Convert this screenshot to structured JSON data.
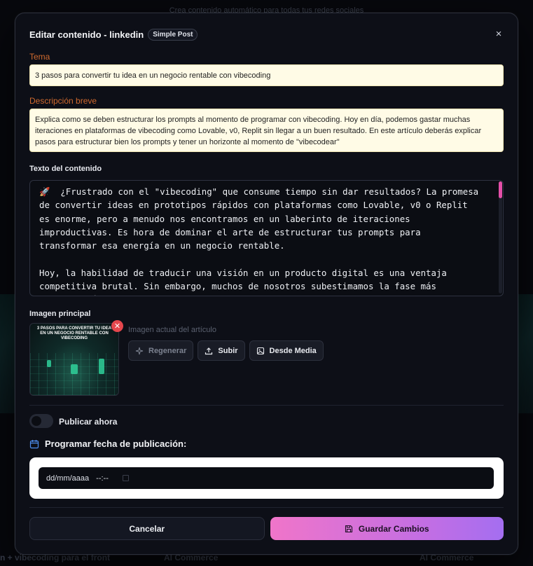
{
  "background": {
    "hint": "Crea contenido automático para todas tus redes sociales",
    "bottom_items": [
      "n + vibecoding para el front",
      "AI Commerce",
      "AI Commerce"
    ]
  },
  "modal": {
    "title": "Editar contenido - linkedin",
    "badge": "Simple Post",
    "close": "×"
  },
  "tema": {
    "label": "Tema",
    "value": "3 pasos para convertir tu idea en un negocio rentable con vibecoding"
  },
  "descripcion": {
    "label": "Descripción breve",
    "value": "Explica como se deben estructurar los prompts al momento de programar con vibecoding. Hoy en día, podemos gastar muchas iteraciones en plataformas de vibecoding como Lovable, v0, Replit sin llegar a un buen resultado. En este artículo deberás explicar pasos para estructurar bien los prompts y tener un horizonte al momento de \"vibecodear\""
  },
  "contenido": {
    "label": "Texto del contenido",
    "value": "🚀  ¿Frustrado con el \"vibecoding\" que consume tiempo sin dar resultados? La promesa de convertir ideas en prototipos rápidos con plataformas como Lovable, v0 o Replit es enorme, pero a menudo nos encontramos en un laberinto de iteraciones improductivas. Es hora de dominar el arte de estructurar tus prompts para transformar esa energía en un negocio rentable.\n\nHoy, la habilidad de traducir una visión en un producto digital es una ventaja competitiva brutal. Sin embargo, muchos de nosotros subestimamos la fase más crítica: cómo nos comunicamos con estas potentes herramientas. Un prompt bien estructurado es la diferencia entre"
  },
  "imagen": {
    "label": "Imagen principal",
    "thumb_caption": "3 PASOS PARA CONVERTIR TU IDEA EN UN NEGOCIO RENTABLE CON VIBECODING",
    "current_label": "Imagen actual del artículo",
    "buttons": {
      "regenerar": "Regenerar",
      "subir": "Subir",
      "media": "Desde Media"
    }
  },
  "publicar": {
    "label": "Publicar ahora",
    "on": false
  },
  "programar": {
    "label": "Programar fecha de publicación:",
    "date_placeholder": "dd/mm/aaaa",
    "time_placeholder": "--:--"
  },
  "footer": {
    "cancel": "Cancelar",
    "save": "Guardar Cambios"
  },
  "colors": {
    "accent_pink": "#f075c9",
    "accent_purple": "#a46ef0",
    "label_orange": "#d06a2e",
    "danger": "#e5474d"
  }
}
